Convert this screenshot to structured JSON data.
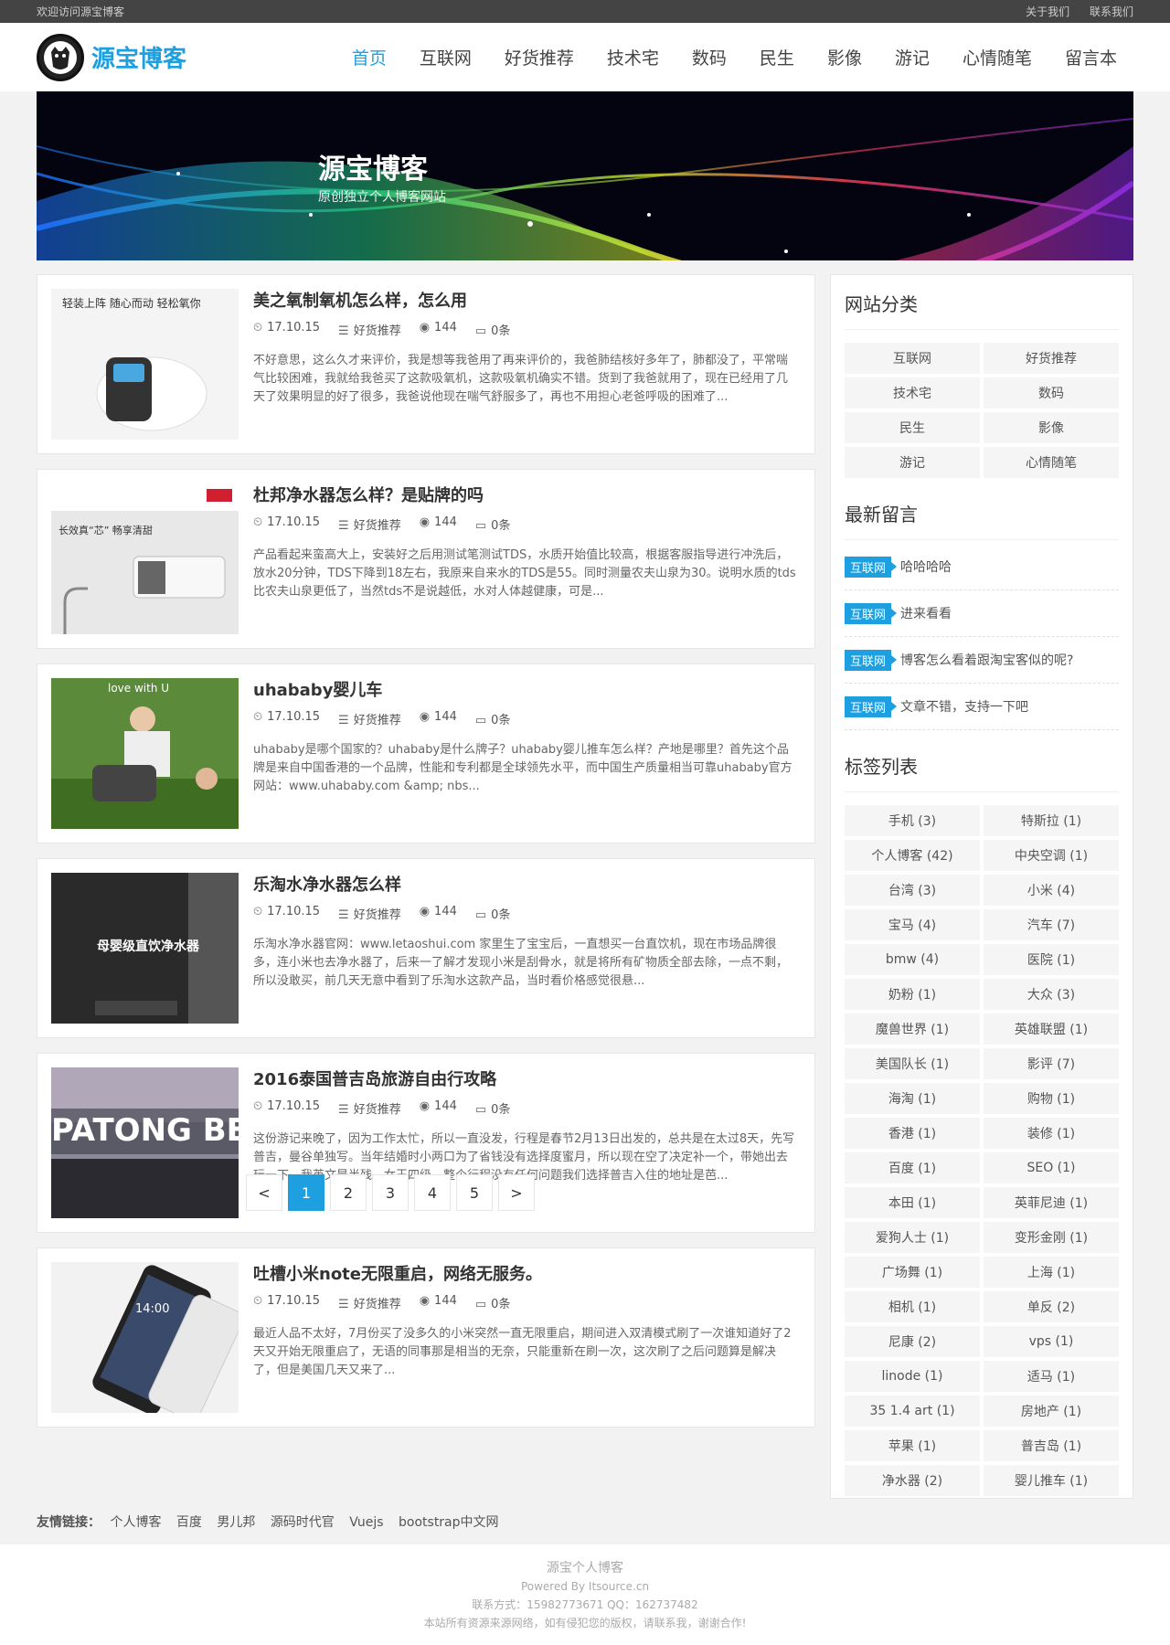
{
  "topbar": {
    "welcome": "欢迎访问源宝博客",
    "about": "关于我们",
    "contact": "联系我们"
  },
  "logo": {
    "text": "源宝博客"
  },
  "nav": [
    "首页",
    "互联网",
    "好货推荐",
    "技术宅",
    "数码",
    "民生",
    "影像",
    "游记",
    "心情随笔",
    "留言本"
  ],
  "banner": {
    "title": "源宝博客",
    "subtitle": "原创独立个人博客网站"
  },
  "posts": [
    {
      "title": "美之氧制氧机怎么样，怎么用",
      "date": "17.10.15",
      "category": "好货推荐",
      "views": "144",
      "comments": "0条",
      "excerpt": "不好意思，这么久才来评价，我是想等我爸用了再来评价的，我爸肺结核好多年了，肺都没了，平常喘气比较困难，我就给我爸买了这款吸氧机，这款吸氧机确实不错。货到了我爸就用了，现在已经用了几天了效果明显的好了很多，我爸说他现在喘气舒服多了，再也不用担心老爸呼吸的困难了...",
      "thumb_text": "轻装上阵  随心而动 轻松氧你"
    },
    {
      "title": "杜邦净水器怎么样？是贴牌的吗",
      "date": "17.10.15",
      "category": "好货推荐",
      "views": "144",
      "comments": "0条",
      "excerpt": "产品看起来蛮高大上，安装好之后用测试笔测试TDS，水质开始值比较高，根据客服指导进行冲洗后，放水20分钟，TDS下降到18左右，我原来自来水的TDS是55。同时测量农夫山泉为30。说明水质的tds比农夫山泉更低了，当然tds不是说越低，水对人体越健康，可是...",
      "thumb_text": "长效真“芯” 畅享清甜"
    },
    {
      "title": "uhababy婴儿车",
      "date": "17.10.15",
      "category": "好货推荐",
      "views": "144",
      "comments": "0条",
      "excerpt": "uhababy是哪个国家的？uhababy是什么牌子？uhababy婴儿推车怎么样？产地是哪里？首先这个品牌是来自中国香港的一个品牌，性能和专利都是全球领先水平，而中国生产质量相当可靠uhababy官方网站：www.uhababy.com &amp; nbs...",
      "thumb_text": "love with U"
    },
    {
      "title": "乐淘水净水器怎么样",
      "date": "17.10.15",
      "category": "好货推荐",
      "views": "144",
      "comments": "0条",
      "excerpt": "乐淘水净水器官网：www.letaoshui.com 家里生了宝宝后，一直想买一台直饮机，现在市场品牌很多，连小米也去净水器了，后来一了解才发现小米是刮骨水，就是将所有矿物质全部去除，一点不剩，所以没敢买，前几天无意中看到了乐淘水这款产品，当时看价格感觉很悬...",
      "thumb_text": "母婴级直饮净水器"
    },
    {
      "title": "2016泰国普吉岛旅游自由行攻略",
      "date": "17.10.15",
      "category": "好货推荐",
      "views": "144",
      "comments": "0条",
      "excerpt": "这份游记来晚了，因为工作太忙，所以一直没发，行程是春节2月13日出发的，总共是在太过8天，先写普吉，曼谷单独写。当年结婚时小两口为了省钱没有选择度蜜月，所以现在空了决定补一个，带她出去玩一下，我英文是半残，女王四级，整个行程没有任何问题我们选择普吉入住的地址是芭...",
      "thumb_text": "PATONG BEA"
    },
    {
      "title": "吐槽小米note无限重启，网络无服务。",
      "date": "17.10.15",
      "category": "好货推荐",
      "views": "144",
      "comments": "0条",
      "excerpt": "最近人品不太好，7月份买了没多久的小米突然一直无限重启，期间进入双清模式刷了一次谁知道好了2天又开始无限重启了，无语的同事那是相当的无奈，只能重新在刷一次，这次刷了之后问题算是解决了，但是美国几天又来了...",
      "thumb_text": "14:00"
    }
  ],
  "pagination": [
    "<",
    "1",
    "2",
    "3",
    "4",
    "5",
    ">"
  ],
  "sidebar": {
    "cat_title": "网站分类",
    "categories": [
      "互联网",
      "好货推荐",
      "技术宅",
      "数码",
      "民生",
      "影像",
      "游记",
      "心情随笔"
    ],
    "msg_title": "最新留言",
    "messages": [
      {
        "tag": "互联网",
        "text": "哈哈哈哈"
      },
      {
        "tag": "互联网",
        "text": "进来看看"
      },
      {
        "tag": "互联网",
        "text": "博客怎么看着跟淘宝客似的呢?"
      },
      {
        "tag": "互联网",
        "text": "文章不错，支持一下吧"
      }
    ],
    "tag_title": "标签列表",
    "tags": [
      "手机 (3)",
      "特斯拉 (1)",
      "个人博客 (42)",
      "中央空调 (1)",
      "台湾 (3)",
      "小米 (4)",
      "宝马 (4)",
      "汽车 (7)",
      "bmw (4)",
      "医院 (1)",
      "奶粉 (1)",
      "大众 (3)",
      "魔兽世界 (1)",
      "英雄联盟 (1)",
      "美国队长 (1)",
      "影评 (7)",
      "海淘 (1)",
      "购物 (1)",
      "香港 (1)",
      "装修 (1)",
      "百度 (1)",
      "SEO (1)",
      "本田 (1)",
      "英菲尼迪 (1)",
      "爱狗人士 (1)",
      "变形金刚 (1)",
      "广场舞 (1)",
      "上海 (1)",
      "相机 (1)",
      "单反 (2)",
      "尼康 (2)",
      "vps (1)",
      "linode (1)",
      "适马 (1)",
      "35 1.4 art (1)",
      "房地产 (1)",
      "苹果 (1)",
      "普吉岛 (1)",
      "净水器 (2)",
      "婴儿推车 (1)"
    ]
  },
  "friends": {
    "label": "友情链接：",
    "links": [
      "个人博客",
      "百度",
      "男儿邦",
      "源码时代官",
      "Vuejs",
      "bootstrap中文网"
    ]
  },
  "footer": {
    "line1": "源宝个人博客",
    "line2": "Powered By Itsource.cn",
    "line3": "联系方式：15982773671   QQ：162737482",
    "line4": "本站所有资源来源网络，如有侵犯您的版权，请联系我，谢谢合作!"
  },
  "colors": {
    "accent": "#1e9fe0",
    "topbar": "#444444",
    "background": "#f2f2f2"
  }
}
